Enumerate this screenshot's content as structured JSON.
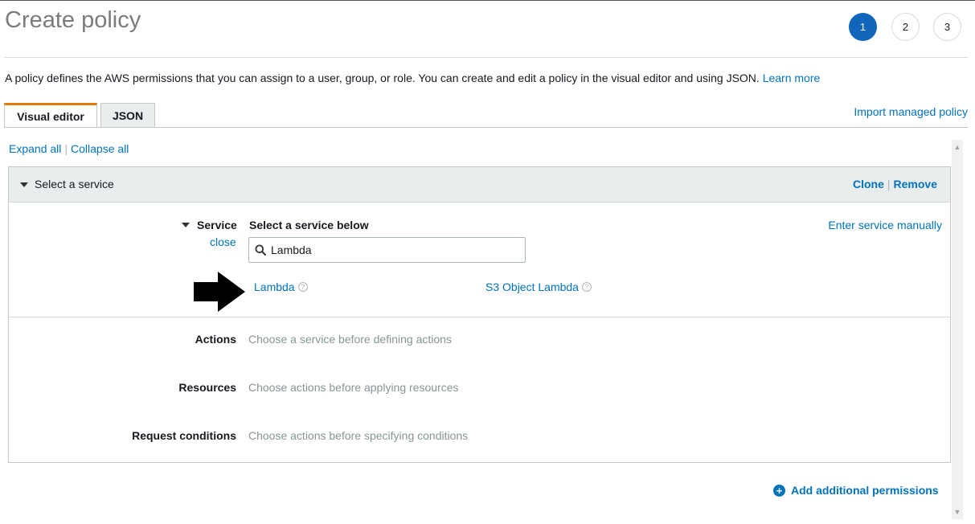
{
  "page": {
    "title": "Create policy",
    "steps": [
      "1",
      "2",
      "3"
    ],
    "active_step": 1,
    "intro_text": "A policy defines the AWS permissions that you can assign to a user, group, or role. You can create and edit a policy in the visual editor and using JSON.",
    "learn_more": "Learn more"
  },
  "tabs": [
    {
      "label": "Visual editor",
      "active": true
    },
    {
      "label": "JSON",
      "active": false
    }
  ],
  "import_link": "Import managed policy",
  "toolbar": {
    "expand_all": "Expand all",
    "collapse_all": "Collapse all"
  },
  "panel": {
    "title": "Select a service",
    "clone": "Clone",
    "remove": "Remove",
    "service": {
      "label": "Service",
      "close": "close",
      "heading": "Select a service below",
      "enter_manually": "Enter service manually",
      "search_value": "Lambda",
      "results": [
        {
          "name": "Lambda",
          "help": "?"
        },
        {
          "name": "S3 Object Lambda",
          "help": "?"
        }
      ]
    },
    "rows": [
      {
        "label": "Actions",
        "value": "Choose a service before defining actions"
      },
      {
        "label": "Resources",
        "value": "Choose actions before applying resources"
      },
      {
        "label": "Request conditions",
        "value": "Choose actions before specifying conditions"
      }
    ]
  },
  "add_permissions": "Add additional permissions",
  "colors": {
    "accent": "#0073bb",
    "step_active": "#1166bb",
    "tab_accent": "#e07b00"
  }
}
